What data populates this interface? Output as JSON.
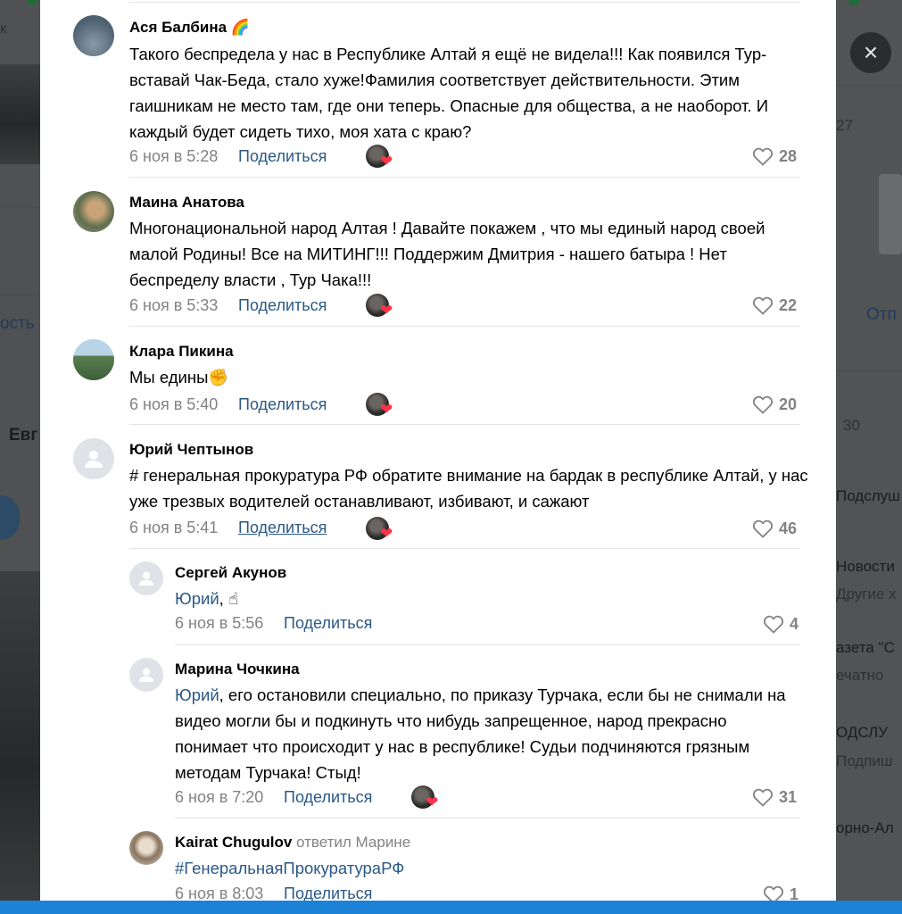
{
  "background": {
    "left_fragments": [
      "к",
      "ость",
      "Евг"
    ],
    "right_fragments": [
      "27",
      "Отп",
      "30",
      "Подслуш",
      "Новости",
      "Другие х",
      "азета \"С",
      "ечатно",
      "ОДСЛУ",
      "Подпиш",
      "орно-Ал"
    ]
  },
  "close_icon": "×",
  "colors": {
    "link": "#2a5885",
    "meta": "#828282",
    "heart": "#ff3347",
    "bar": "#1b82d8"
  },
  "comments": [
    {
      "author": "Ася Балбина",
      "badge": "🌈",
      "text": "Такого беспредела у нас в Республике Алтай я ещё не видела!!! Как появился Тур-вставай Чак-Беда, стало хуже!Фамилия соответствует действительности. Этим гаишникам не место там, где они теперь. Опасные для общества, а не наоборот. И каждый будет сидеть тихо, моя хата с краю?",
      "date": "6 ноя в 5:28",
      "share": "Поделиться",
      "likes": "28"
    },
    {
      "author": "Маина Анатова",
      "text": "Многонациональной народ Алтая ! Давайте покажем , что мы единый народ своей малой Родины! Все на МИТИНГ!!! Поддержим Дмитрия - нашего батыра ! Нет беспределу власти , Тур Чака!!!",
      "date": "6 ноя в 5:33",
      "share": "Поделиться",
      "likes": "22"
    },
    {
      "author": "Клара Пикина",
      "text": "Мы едины",
      "emoji": "✊",
      "date": "6 ноя в 5:40",
      "share": "Поделиться",
      "likes": "20"
    },
    {
      "author": "Юрий Чептынов",
      "text": "# генеральная прокуратура РФ обратите внимание на бардак в республике Алтай, у нас уже трезвых водителей останавливают, избивают, и сажают",
      "date": "6 ноя в 5:41",
      "share": "Поделиться",
      "likes": "46"
    }
  ],
  "replies": [
    {
      "author": "Сергей Акунов",
      "mention": "Юрий",
      "text": ", ",
      "emoji": "☝",
      "date": "6 ноя в 5:56",
      "share": "Поделиться",
      "likes": "4"
    },
    {
      "author": "Марина Чочкина",
      "mention": "Юрий",
      "text": ", его остановили специально, по приказу Турчака, если бы не снимали на видео могли бы и подкинуть что нибудь запрещенное, народ прекрасно понимает что происходит у нас в республике! Судьи подчиняются грязным методам Турчака! Стыд!",
      "date": "6 ноя в 7:20",
      "share": "Поделиться",
      "likes": "31"
    },
    {
      "author": "Kairat Chugulov",
      "replied_to": "ответил Марине",
      "hashtag": "#ГенеральнаяПрокуратураРФ",
      "date": "6 ноя в 8:03",
      "share": "Поделиться",
      "likes": "1"
    }
  ]
}
